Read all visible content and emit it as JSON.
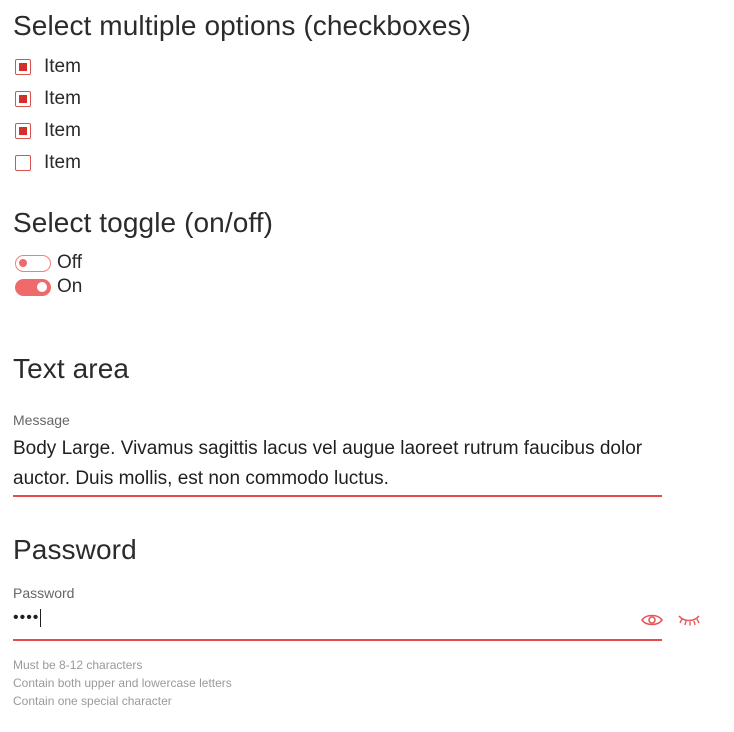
{
  "checkbox_section": {
    "title": "Select multiple options (checkboxes)",
    "items": [
      {
        "label": "Item",
        "checked": true
      },
      {
        "label": "Item",
        "checked": true
      },
      {
        "label": "Item",
        "checked": true
      },
      {
        "label": "Item",
        "checked": false
      }
    ]
  },
  "toggle_section": {
    "title": "Select toggle (on/off)",
    "toggles": [
      {
        "label": "Off",
        "state": "off"
      },
      {
        "label": "On",
        "state": "on"
      }
    ]
  },
  "textarea_section": {
    "title": "Text area",
    "field_label": "Message",
    "value": "Body Large. Vivamus sagittis lacus vel augue laoreet rutrum faucibus dolor auctor. Duis mollis, est non commodo luctus."
  },
  "password_section": {
    "title": "Password",
    "field_label": "Password",
    "masked_value": "••••",
    "show_icon": "eye-icon",
    "hide_icon": "eye-closed-icon",
    "hints": [
      "Must be 8-12 characters",
      "Contain both upper and lowercase letters",
      "Contain one special character"
    ]
  },
  "colors": {
    "accent": "#d32f2f",
    "toggle": "#ef6b6b",
    "underline": "#e74c4c"
  }
}
